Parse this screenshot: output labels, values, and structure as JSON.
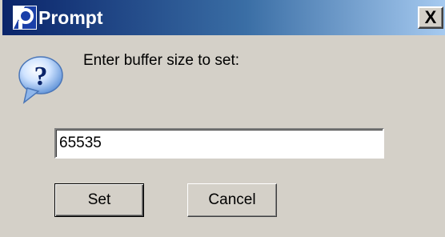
{
  "window": {
    "title": "Prompt",
    "close_label": "X"
  },
  "icons": {
    "title": "app-icon",
    "dialog": "question-icon",
    "close": "close-icon"
  },
  "dialog": {
    "prompt_text": "Enter buffer size to set:",
    "input_value": "65535",
    "set_label": "Set",
    "cancel_label": "Cancel"
  },
  "colors": {
    "titlebar_start": "#0a246a",
    "titlebar_end": "#a6caf0",
    "face": "#d4d0c8"
  }
}
